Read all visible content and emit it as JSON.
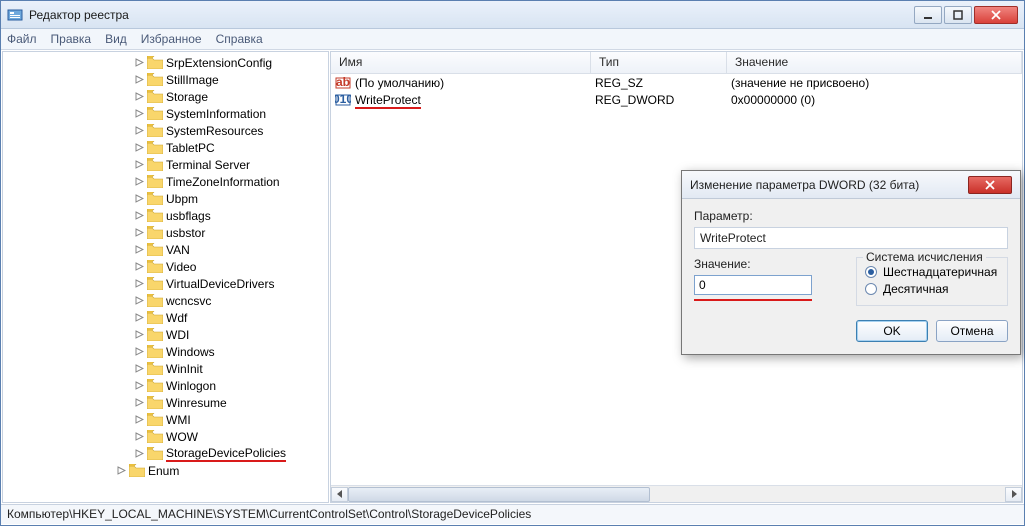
{
  "window": {
    "title": "Редактор реестра"
  },
  "menu": {
    "file": "Файл",
    "edit": "Правка",
    "view": "Вид",
    "fav": "Избранное",
    "help": "Справка"
  },
  "tree": {
    "items": [
      {
        "label": "SrpExtensionConfig"
      },
      {
        "label": "StillImage"
      },
      {
        "label": "Storage"
      },
      {
        "label": "SystemInformation"
      },
      {
        "label": "SystemResources"
      },
      {
        "label": "TabletPC"
      },
      {
        "label": "Terminal Server"
      },
      {
        "label": "TimeZoneInformation"
      },
      {
        "label": "Ubpm"
      },
      {
        "label": "usbflags"
      },
      {
        "label": "usbstor"
      },
      {
        "label": "VAN"
      },
      {
        "label": "Video"
      },
      {
        "label": "VirtualDeviceDrivers"
      },
      {
        "label": "wcncsvc"
      },
      {
        "label": "Wdf"
      },
      {
        "label": "WDI"
      },
      {
        "label": "Windows"
      },
      {
        "label": "WinInit"
      },
      {
        "label": "Winlogon"
      },
      {
        "label": "Winresume"
      },
      {
        "label": "WMI"
      },
      {
        "label": "WOW"
      },
      {
        "label": "StorageDevicePolicies",
        "selected": true
      },
      {
        "label": "Enum",
        "indent": -1
      }
    ]
  },
  "list": {
    "columns": {
      "name": "Имя",
      "type": "Тип",
      "value": "Значение"
    },
    "rows": [
      {
        "name": "(По умолчанию)",
        "type": "REG_SZ",
        "value": "(значение не присвоено)",
        "icon": "str"
      },
      {
        "name": "WriteProtect",
        "type": "REG_DWORD",
        "value": "0x00000000 (0)",
        "icon": "bin",
        "under": true
      }
    ]
  },
  "dialog": {
    "title": "Изменение параметра DWORD (32 бита)",
    "param_label": "Параметр:",
    "param_value": "WriteProtect",
    "value_label": "Значение:",
    "value_input": "0",
    "base_label": "Система исчисления",
    "hex": "Шестнадцатеричная",
    "dec": "Десятичная",
    "ok": "OK",
    "cancel": "Отмена"
  },
  "status": {
    "path": "Компьютер\\HKEY_LOCAL_MACHINE\\SYSTEM\\CurrentControlSet\\Control\\StorageDevicePolicies"
  }
}
